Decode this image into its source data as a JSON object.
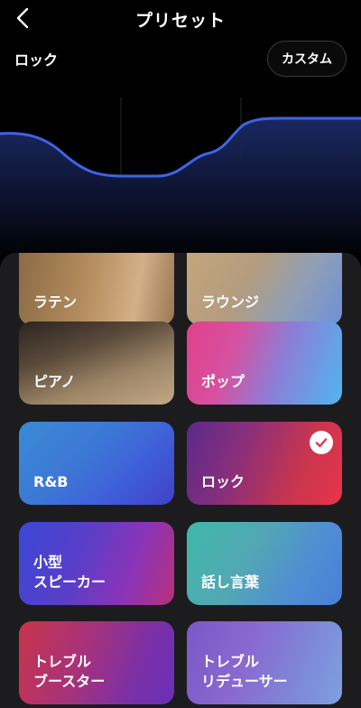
{
  "header": {
    "title": "プリセット"
  },
  "current_preset": "ロック",
  "custom_button": "カスタム",
  "presets": [
    {
      "label": "ラテン",
      "selected": false
    },
    {
      "label": "ラウンジ",
      "selected": false
    },
    {
      "label": "ピアノ",
      "selected": false
    },
    {
      "label": "ポップ",
      "selected": false
    },
    {
      "label": "R&B",
      "selected": false
    },
    {
      "label": "ロック",
      "selected": true
    },
    {
      "label": "小型\nスピーカー",
      "selected": false
    },
    {
      "label": "話し言葉",
      "selected": false
    },
    {
      "label": "トレブル\nブースター",
      "selected": false
    },
    {
      "label": "トレブル\nリデューサー",
      "selected": false
    }
  ],
  "colors": {
    "curve": "#3f63e6",
    "accent_check": "#e8344a"
  }
}
